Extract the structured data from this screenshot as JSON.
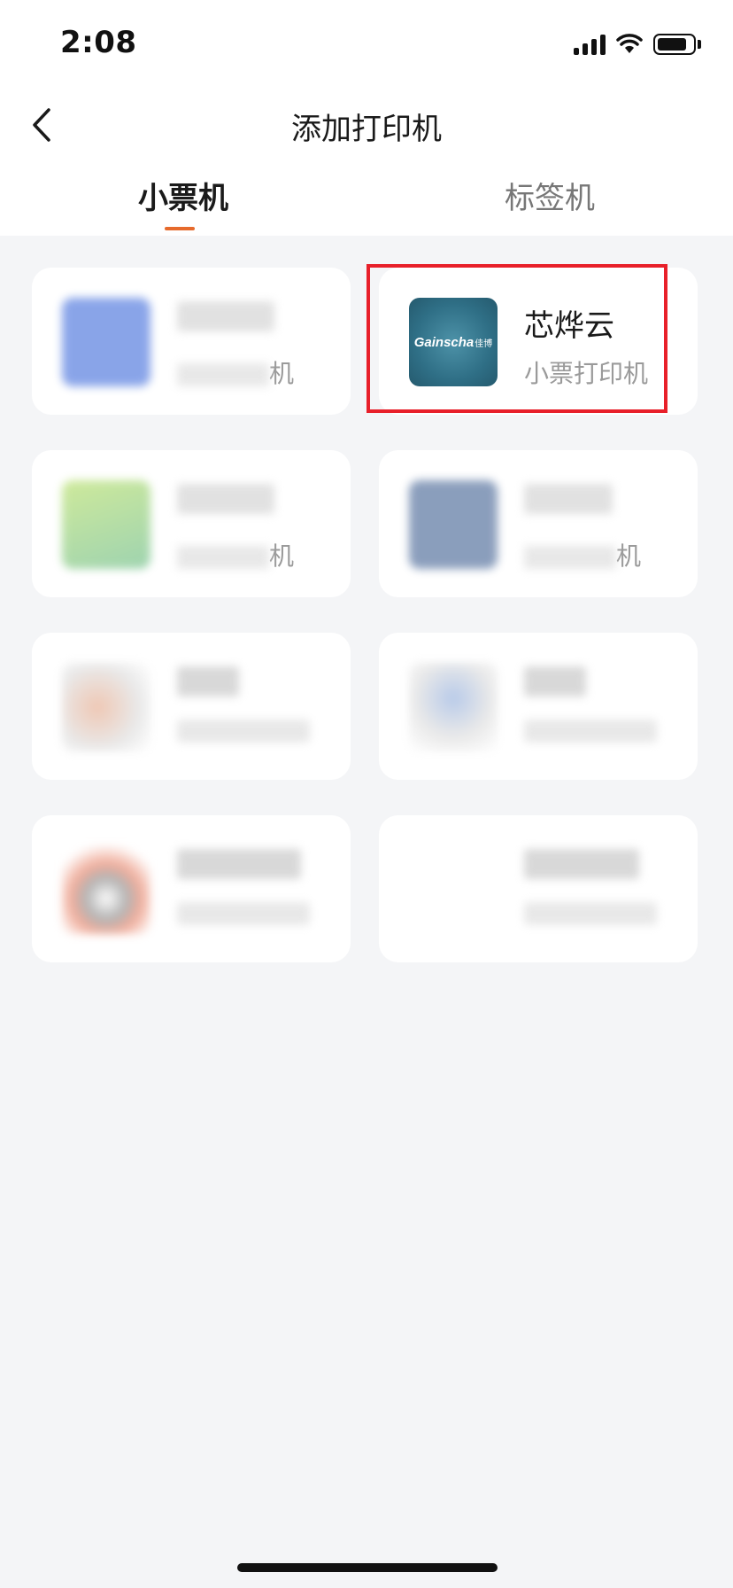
{
  "status": {
    "time": "2:08",
    "battery_level": 0.75
  },
  "nav": {
    "title": "添加打印机",
    "back_icon": "chevron-left-icon"
  },
  "tabs": [
    {
      "label": "小票机",
      "active": true
    },
    {
      "label": "标签机",
      "active": false
    }
  ],
  "printers": [
    {
      "name": "",
      "subtitle": "机",
      "logo_color": "#2a5bd7",
      "blurred": true
    },
    {
      "name": "芯烨云",
      "subtitle": "小票打印机",
      "logo_text": "Gainscha",
      "logo_suffix": "佳博",
      "logo_color": "#2f6f86",
      "blurred": false,
      "selected": true
    },
    {
      "name": "",
      "subtitle": "机",
      "logo_color": "#6cc04a",
      "blurred": true
    },
    {
      "name": "",
      "subtitle": "机",
      "logo_color": "#2c4f86",
      "blurred": true
    },
    {
      "name": "",
      "subtitle": "",
      "logo_color": "#e39b78",
      "blurred": true
    },
    {
      "name": "",
      "subtitle": "",
      "logo_color": "#7fa0d8",
      "blurred": true
    },
    {
      "name": "",
      "subtitle": "",
      "logo_color": "#e46b4b",
      "blurred": true
    },
    {
      "name": "",
      "subtitle": "",
      "logo_color": "#ffffff",
      "blurred": true
    }
  ],
  "colors": {
    "accent": "#e66a2c",
    "highlight": "#e8202a",
    "background": "#f4f5f7"
  }
}
